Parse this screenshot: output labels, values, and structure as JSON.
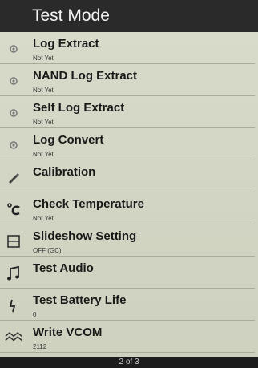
{
  "header": {
    "title": "Test Mode"
  },
  "menu": {
    "items": [
      {
        "label": "Log Extract",
        "sub": "Not Yet",
        "icon": "gear-icon"
      },
      {
        "label": "NAND Log Extract",
        "sub": "Not Yet",
        "icon": "gear-icon"
      },
      {
        "label": "Self Log Extract",
        "sub": "Not Yet",
        "icon": "gear-icon"
      },
      {
        "label": "Log Convert",
        "sub": "Not Yet",
        "icon": "gear-icon"
      },
      {
        "label": "Calibration",
        "sub": "",
        "icon": "pen-icon"
      },
      {
        "label": "Check Temperature",
        "sub": "Not Yet",
        "icon": "celsius-icon"
      },
      {
        "label": "Slideshow Setting",
        "sub": "OFF (GC)",
        "icon": "slideshow-icon"
      },
      {
        "label": "Test Audio",
        "sub": "",
        "icon": "music-note-icon"
      },
      {
        "label": "Test Battery Life",
        "sub": "0",
        "icon": "battery-bolt-icon"
      },
      {
        "label": "Write VCOM",
        "sub": "2112",
        "icon": "wave-icon"
      }
    ]
  },
  "footer": {
    "page_indicator": "2 of 3"
  }
}
